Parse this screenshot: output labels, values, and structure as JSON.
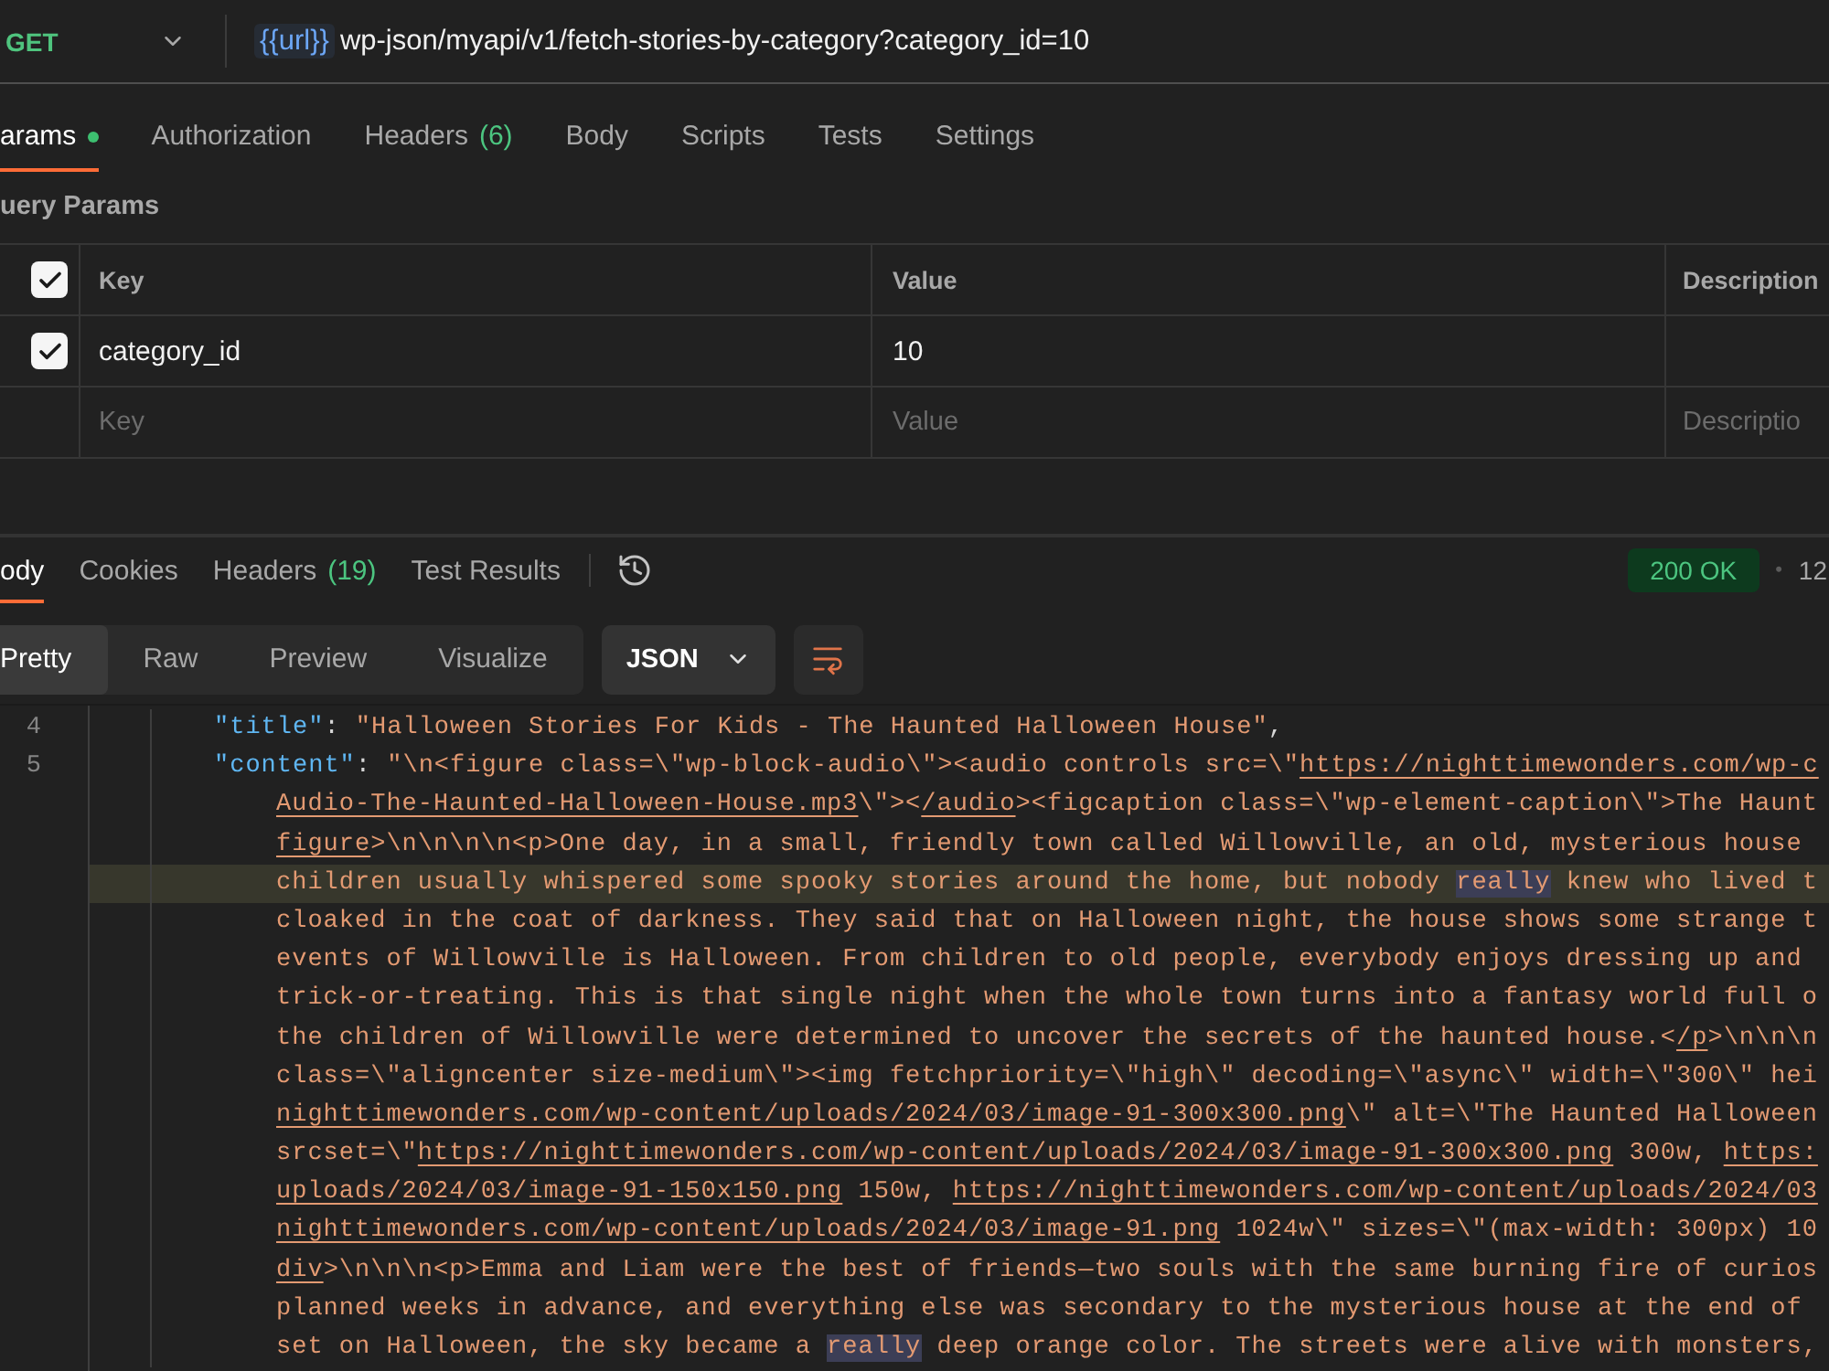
{
  "request": {
    "method": "GET",
    "url": {
      "variable": "{{url}}",
      "path": "wp-json/myapi/v1/fetch-stories-by-category?category_id=10"
    }
  },
  "request_tabs": [
    {
      "label": "arams",
      "selected": true,
      "dot": true
    },
    {
      "label": "Authorization",
      "selected": false,
      "dot": false
    },
    {
      "label": "Headers",
      "count": "(6)",
      "selected": false,
      "dot": false
    },
    {
      "label": "Body",
      "selected": false,
      "dot": false
    },
    {
      "label": "Scripts",
      "selected": false,
      "dot": false
    },
    {
      "label": "Tests",
      "selected": false,
      "dot": false
    },
    {
      "label": "Settings",
      "selected": false,
      "dot": false
    }
  ],
  "query_params": {
    "title": "uery Params",
    "columns": [
      "Key",
      "Value",
      "Description"
    ],
    "all_checked": true,
    "rows": [
      {
        "checked": true,
        "key": "category_id",
        "value": "10"
      }
    ],
    "new_row": {
      "key_placeholder": "Key",
      "value_placeholder": "Value",
      "description_placeholder": "Descriptio"
    }
  },
  "response": {
    "tabs": [
      {
        "label": "ody",
        "selected": true
      },
      {
        "label": "Cookies",
        "selected": false
      },
      {
        "label": "Headers",
        "count": "(19)",
        "selected": false
      },
      {
        "label": "Test Results",
        "selected": false
      }
    ],
    "status": "200 OK",
    "separator": "•",
    "time": "12"
  },
  "view_modes": [
    {
      "label": "Pretty",
      "selected": true
    },
    {
      "label": "Raw",
      "selected": false
    },
    {
      "label": "Preview",
      "selected": false
    },
    {
      "label": "Visualize",
      "selected": false
    }
  ],
  "format": "JSON",
  "code": {
    "lines": [
      {
        "number": "4",
        "current": false,
        "segments": [
          {
            "kind": "key",
            "text": "\"title\""
          },
          {
            "kind": "punct",
            "text": ": "
          },
          {
            "kind": "string",
            "text": "\"Halloween Stories For Kids - The Haunted Halloween House\""
          },
          {
            "kind": "punct",
            "text": ","
          }
        ]
      },
      {
        "number": "5",
        "current": false,
        "segments": [
          {
            "kind": "key",
            "text": "\"content\""
          },
          {
            "kind": "punct",
            "text": ": "
          },
          {
            "kind": "string",
            "text": "\"\\n<figure class=\\\"wp-block-audio\\\"><audio controls src=\\\""
          },
          {
            "kind": "link",
            "text": "https://nighttimewonders.com/wp-c"
          }
        ]
      },
      {
        "current": false,
        "segments": [
          {
            "kind": "link",
            "text": "Audio-The-Haunted-Halloween-House.mp3"
          },
          {
            "kind": "string",
            "text": "\\\"><"
          },
          {
            "kind": "link",
            "text": "/audio"
          },
          {
            "kind": "string",
            "text": "><figcaption class=\\\"wp-element-caption\\\">The Haunt"
          }
        ]
      },
      {
        "current": false,
        "segments": [
          {
            "kind": "link",
            "text": "figure"
          },
          {
            "kind": "string",
            "text": ">\\n\\n\\n\\n<p>One day, in a small, friendly town called Willowville, an old, mysterious house"
          }
        ]
      },
      {
        "current": true,
        "segments": [
          {
            "kind": "string",
            "text": "children usually whispered some spooky stories around the home, but nobody "
          },
          {
            "kind": "match",
            "text": "really"
          },
          {
            "kind": "string",
            "text": " knew who lived t"
          }
        ]
      },
      {
        "current": false,
        "segments": [
          {
            "kind": "string",
            "text": "cloaked in the coat of darkness. They said that on Halloween night, the house shows some strange t"
          }
        ]
      },
      {
        "current": false,
        "segments": [
          {
            "kind": "string",
            "text": "events of Willowville is Halloween. From children to old people, everybody enjoys dressing up and"
          }
        ]
      },
      {
        "current": false,
        "segments": [
          {
            "kind": "string",
            "text": "trick-or-treating. This is that single night when the whole town turns into a fantasy world full o"
          }
        ]
      },
      {
        "current": false,
        "segments": [
          {
            "kind": "string",
            "text": "the children of Willowville were determined to uncover the secrets of the haunted house.<"
          },
          {
            "kind": "link",
            "text": "/p"
          },
          {
            "kind": "string",
            "text": ">\\n\\n\\n"
          }
        ]
      },
      {
        "current": false,
        "segments": [
          {
            "kind": "string",
            "text": "class=\\\"aligncenter size-medium\\\"><img fetchpriority=\\\"high\\\" decoding=\\\"async\\\" width=\\\"300\\\" hei"
          }
        ]
      },
      {
        "current": false,
        "segments": [
          {
            "kind": "link",
            "text": "nighttimewonders.com/wp-content/uploads/2024/03/image-91-300x300.png"
          },
          {
            "kind": "string",
            "text": "\\\" alt=\\\"The Haunted Halloween"
          }
        ]
      },
      {
        "current": false,
        "segments": [
          {
            "kind": "string",
            "text": "srcset=\\\""
          },
          {
            "kind": "link",
            "text": "https://nighttimewonders.com/wp-content/uploads/2024/03/image-91-300x300.png"
          },
          {
            "kind": "string",
            "text": " 300w, "
          },
          {
            "kind": "link",
            "text": "https:"
          }
        ]
      },
      {
        "current": false,
        "segments": [
          {
            "kind": "link",
            "text": "uploads/2024/03/image-91-150x150.png"
          },
          {
            "kind": "string",
            "text": " 150w, "
          },
          {
            "kind": "link",
            "text": "https://nighttimewonders.com/wp-content/uploads/2024/03"
          }
        ]
      },
      {
        "current": false,
        "segments": [
          {
            "kind": "link",
            "text": "nighttimewonders.com/wp-content/uploads/2024/03/image-91.png"
          },
          {
            "kind": "string",
            "text": " 1024w\\\" sizes=\\\"(max-width: 300px) 10"
          }
        ]
      },
      {
        "current": false,
        "segments": [
          {
            "kind": "link",
            "text": "div"
          },
          {
            "kind": "string",
            "text": ">\\n\\n\\n<p>Emma and Liam were the best of friends—two souls with the same burning fire of curios"
          }
        ]
      },
      {
        "current": false,
        "segments": [
          {
            "kind": "string",
            "text": "planned weeks in advance, and everything else was secondary to the mysterious house at the end of"
          }
        ]
      },
      {
        "current": false,
        "segments": [
          {
            "kind": "string",
            "text": "set on Halloween, the sky became a "
          },
          {
            "kind": "match",
            "text": "really"
          },
          {
            "kind": "string",
            "text": " deep orange color. The streets were alive with monsters,"
          }
        ]
      }
    ]
  }
}
